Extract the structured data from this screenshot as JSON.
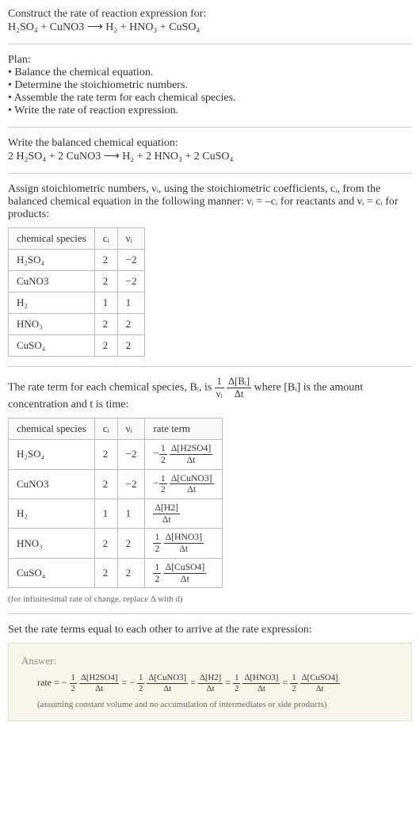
{
  "prompt": {
    "line1": "Construct the rate of reaction expression for:",
    "equation": "H₂SO₄ + CuNO3 ⟶ H₂ + HNO₃ + CuSO₄"
  },
  "plan": {
    "heading": "Plan:",
    "bullets": [
      "• Balance the chemical equation.",
      "• Determine the stoichiometric numbers.",
      "• Assemble the rate term for each chemical species.",
      "• Write the rate of reaction expression."
    ]
  },
  "balanced": {
    "heading": "Write the balanced chemical equation:",
    "equation": "2 H₂SO₄ + 2 CuNO3 ⟶ H₂ + 2 HNO₃ + 2 CuSO₄"
  },
  "stoich_text": "Assign stoichiometric numbers, νᵢ, using the stoichiometric coefficients, cᵢ, from the balanced chemical equation in the following manner: νᵢ = –cᵢ for reactants and νᵢ = cᵢ for products:",
  "table1": {
    "headers": [
      "chemical species",
      "cᵢ",
      "νᵢ"
    ],
    "rows": [
      [
        "H₂SO₄",
        "2",
        "−2"
      ],
      [
        "CuNO3",
        "2",
        "−2"
      ],
      [
        "H₂",
        "1",
        "1"
      ],
      [
        "HNO₃",
        "2",
        "2"
      ],
      [
        "CuSO₄",
        "2",
        "2"
      ]
    ]
  },
  "rate_term_text_a": "The rate term for each chemical species, Bᵢ, is ",
  "rate_term_text_b": " where [Bᵢ] is the amount concentration and t is time:",
  "table2": {
    "headers": [
      "chemical species",
      "cᵢ",
      "νᵢ",
      "rate term"
    ],
    "rows": [
      {
        "sp": "H₂SO₄",
        "c": "2",
        "v": "−2",
        "sign": "−",
        "coef_num": "1",
        "coef_den": "2",
        "conc": "Δ[H2SO4]",
        "dt": "Δt"
      },
      {
        "sp": "CuNO3",
        "c": "2",
        "v": "−2",
        "sign": "−",
        "coef_num": "1",
        "coef_den": "2",
        "conc": "Δ[CuNO3]",
        "dt": "Δt"
      },
      {
        "sp": "H₂",
        "c": "1",
        "v": "1",
        "sign": "",
        "coef_num": "",
        "coef_den": "",
        "conc": "Δ[H2]",
        "dt": "Δt"
      },
      {
        "sp": "HNO₃",
        "c": "2",
        "v": "2",
        "sign": "",
        "coef_num": "1",
        "coef_den": "2",
        "conc": "Δ[HNO3]",
        "dt": "Δt"
      },
      {
        "sp": "CuSO₄",
        "c": "2",
        "v": "2",
        "sign": "",
        "coef_num": "1",
        "coef_den": "2",
        "conc": "Δ[CuSO4]",
        "dt": "Δt"
      }
    ]
  },
  "inf_note": "(for infinitesimal rate of change, replace Δ with d)",
  "final_heading": "Set the rate terms equal to each other to arrive at the rate expression:",
  "answer_label": "Answer:",
  "answer_expr_prefix": "rate = ",
  "answer_terms": [
    {
      "sign": "−",
      "num": "1",
      "den": "2",
      "conc": "Δ[H2SO4]",
      "dt": "Δt"
    },
    {
      "sign": "−",
      "num": "1",
      "den": "2",
      "conc": "Δ[CuNO3]",
      "dt": "Δt"
    },
    {
      "sign": "",
      "num": "",
      "den": "",
      "conc": "Δ[H2]",
      "dt": "Δt"
    },
    {
      "sign": "",
      "num": "1",
      "den": "2",
      "conc": "Δ[HNO3]",
      "dt": "Δt"
    },
    {
      "sign": "",
      "num": "1",
      "den": "2",
      "conc": "Δ[CuSO4]",
      "dt": "Δt"
    }
  ],
  "answer_note": "(assuming constant volume and no accumulation of intermediates or side products)",
  "chart_data": {
    "type": "table",
    "title": "Stoichiometric coefficients and rate terms",
    "tables": [
      {
        "columns": [
          "chemical species",
          "c_i",
          "ν_i"
        ],
        "rows": [
          [
            "H2SO4",
            2,
            -2
          ],
          [
            "CuNO3",
            2,
            -2
          ],
          [
            "H2",
            1,
            1
          ],
          [
            "HNO3",
            2,
            2
          ],
          [
            "CuSO4",
            2,
            2
          ]
        ]
      },
      {
        "columns": [
          "chemical species",
          "c_i",
          "ν_i",
          "rate term"
        ],
        "rows": [
          [
            "H2SO4",
            2,
            -2,
            "-(1/2) Δ[H2SO4]/Δt"
          ],
          [
            "CuNO3",
            2,
            -2,
            "-(1/2) Δ[CuNO3]/Δt"
          ],
          [
            "H2",
            1,
            1,
            "Δ[H2]/Δt"
          ],
          [
            "HNO3",
            2,
            2,
            "(1/2) Δ[HNO3]/Δt"
          ],
          [
            "CuSO4",
            2,
            2,
            "(1/2) Δ[CuSO4]/Δt"
          ]
        ]
      }
    ],
    "rate_expression": "rate = -(1/2) Δ[H2SO4]/Δt = -(1/2) Δ[CuNO3]/Δt = Δ[H2]/Δt = (1/2) Δ[HNO3]/Δt = (1/2) Δ[CuSO4]/Δt"
  }
}
